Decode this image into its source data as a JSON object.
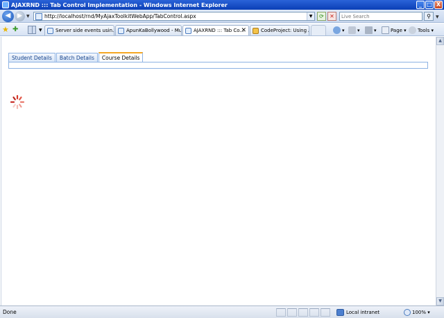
{
  "window": {
    "title": "AJAXRND ::: Tab Control Implementation - Windows Internet Explorer",
    "minimize": "_",
    "maximize": "□",
    "close": "X"
  },
  "address_bar": {
    "url": "http://localhost/rnd/MyAjaxToolkitWebApp/TabControl.aspx",
    "search_placeholder": "Live Search"
  },
  "browser_tabs": [
    {
      "label": "Server side events usin..."
    },
    {
      "label": "ApunKaBollywood - Musi..."
    },
    {
      "label": "AJAXRND ::: Tab Co..."
    },
    {
      "label": "CodeProject: Using ASP..."
    }
  ],
  "commands": {
    "page": "Page",
    "tools": "Tools"
  },
  "page_tabs": [
    {
      "label": "Student Details",
      "active": false
    },
    {
      "label": "Batch Details",
      "active": false
    },
    {
      "label": "Course Details",
      "active": true
    }
  ],
  "status": {
    "text": "Done",
    "zone": "Local intranet",
    "zoom": "100%"
  }
}
